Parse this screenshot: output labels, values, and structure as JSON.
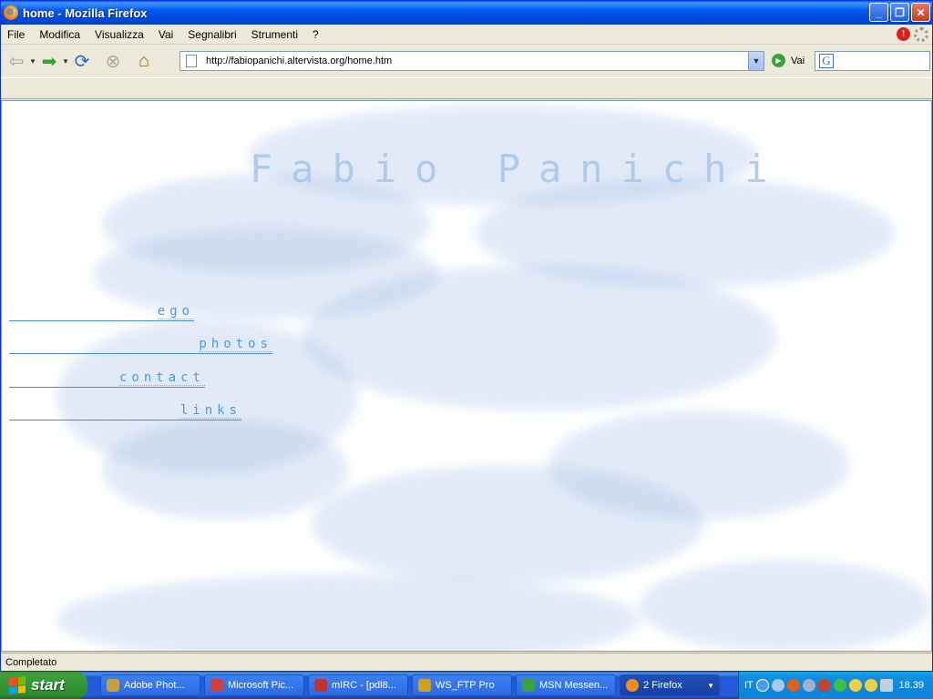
{
  "window": {
    "title": "home - Mozilla Firefox",
    "buttons": [
      "minimize",
      "restore",
      "close"
    ]
  },
  "menu": [
    "File",
    "Modifica",
    "Visualizza",
    "Vai",
    "Segnalibri",
    "Strumenti",
    "?"
  ],
  "toolbar": {
    "url": "http://fabiopanichi.altervista.org/home.htm",
    "go_label": "Vai",
    "search_value": ""
  },
  "page": {
    "title": "Fabio Panichi",
    "links": [
      "ego",
      "photos",
      "contact",
      "links"
    ]
  },
  "status": "Completato",
  "taskbar": {
    "start_label": "start",
    "tasks": [
      {
        "label": "Adobe Phot...",
        "icon_color": "#c8a040"
      },
      {
        "label": "Microsoft Pic...",
        "icon_color": "#d04040"
      },
      {
        "label": "mIRC - [pdl8...",
        "icon_color": "#c03030"
      },
      {
        "label": "WS_FTP Pro",
        "icon_color": "#d0a020"
      },
      {
        "label": "MSN Messen...",
        "icon_color": "#40a040"
      },
      {
        "label": "2 Firefox",
        "icon_color": "#f28b1e"
      }
    ],
    "language": "IT",
    "clock": "18.39"
  }
}
